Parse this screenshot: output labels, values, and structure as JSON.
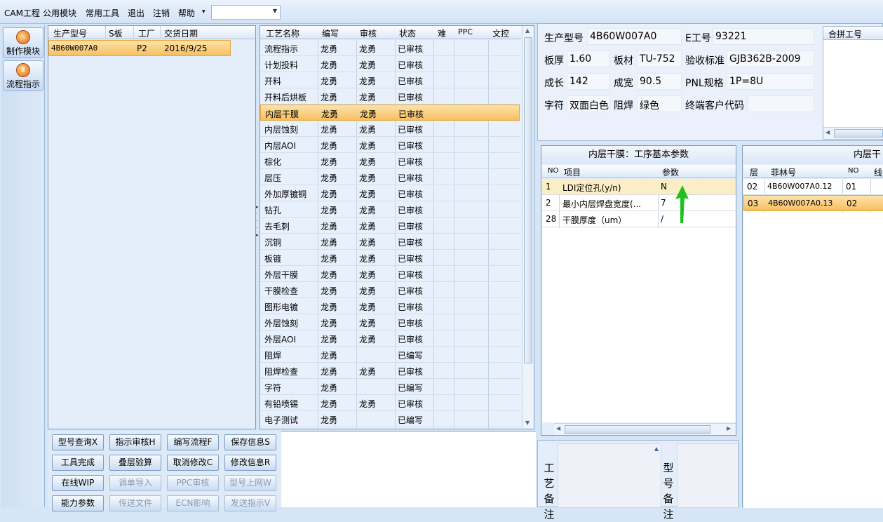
{
  "menu": {
    "items": [
      "CAM工程",
      "公用模块",
      "常用工具",
      "退出",
      "注销",
      "帮助"
    ],
    "dropdown_arrow": "▾",
    "combo_value": ""
  },
  "nav": {
    "make_module": "制作模块",
    "flow_guide": "流程指示"
  },
  "model_table": {
    "headers": [
      "生产型号",
      "S板",
      "工厂",
      "交货日期"
    ],
    "rows": [
      {
        "model": "4B60W007A0",
        "s": "",
        "factory": "P2",
        "date": "2016/9/25"
      }
    ]
  },
  "process_table": {
    "headers": [
      "工艺名称",
      "编写",
      "审核",
      "状态",
      "难",
      "PPC",
      "文控"
    ],
    "selected_index": 4,
    "rows": [
      {
        "name": "流程指示",
        "writer": "龙勇",
        "reviewer": "龙勇",
        "status": "已审核"
      },
      {
        "name": "计划投料",
        "writer": "龙勇",
        "reviewer": "龙勇",
        "status": "已审核"
      },
      {
        "name": "开料",
        "writer": "龙勇",
        "reviewer": "龙勇",
        "status": "已审核"
      },
      {
        "name": "开料后烘板",
        "writer": "龙勇",
        "reviewer": "龙勇",
        "status": "已审核"
      },
      {
        "name": "内层干膜",
        "writer": "龙勇",
        "reviewer": "龙勇",
        "status": "已审核"
      },
      {
        "name": "内层蚀刻",
        "writer": "龙勇",
        "reviewer": "龙勇",
        "status": "已审核"
      },
      {
        "name": "内层AOI",
        "writer": "龙勇",
        "reviewer": "龙勇",
        "status": "已审核"
      },
      {
        "name": "棕化",
        "writer": "龙勇",
        "reviewer": "龙勇",
        "status": "已审核"
      },
      {
        "name": "层压",
        "writer": "龙勇",
        "reviewer": "龙勇",
        "status": "已审核"
      },
      {
        "name": "外加厚镀铜",
        "writer": "龙勇",
        "reviewer": "龙勇",
        "status": "已审核"
      },
      {
        "name": "钻孔",
        "writer": "龙勇",
        "reviewer": "龙勇",
        "status": "已审核"
      },
      {
        "name": "去毛刺",
        "writer": "龙勇",
        "reviewer": "龙勇",
        "status": "已审核"
      },
      {
        "name": "沉铜",
        "writer": "龙勇",
        "reviewer": "龙勇",
        "status": "已审核"
      },
      {
        "name": "板镀",
        "writer": "龙勇",
        "reviewer": "龙勇",
        "status": "已审核"
      },
      {
        "name": "外层干膜",
        "writer": "龙勇",
        "reviewer": "龙勇",
        "status": "已审核"
      },
      {
        "name": "干膜检查",
        "writer": "龙勇",
        "reviewer": "龙勇",
        "status": "已审核"
      },
      {
        "name": "图形电镀",
        "writer": "龙勇",
        "reviewer": "龙勇",
        "status": "已审核"
      },
      {
        "name": "外层蚀刻",
        "writer": "龙勇",
        "reviewer": "龙勇",
        "status": "已审核"
      },
      {
        "name": "外层AOI",
        "writer": "龙勇",
        "reviewer": "龙勇",
        "status": "已审核"
      },
      {
        "name": "阻焊",
        "writer": "龙勇",
        "reviewer": "",
        "status": "已编写"
      },
      {
        "name": "阻焊检查",
        "writer": "龙勇",
        "reviewer": "龙勇",
        "status": "已审核"
      },
      {
        "name": "字符",
        "writer": "龙勇",
        "reviewer": "",
        "status": "已编写"
      },
      {
        "name": "有铅喷锡",
        "writer": "龙勇",
        "reviewer": "龙勇",
        "status": "已审核"
      },
      {
        "name": "电子测试",
        "writer": "龙勇",
        "reviewer": "",
        "status": "已编写"
      }
    ]
  },
  "info": {
    "model_label": "生产型号",
    "model_value": "4B60W007A0",
    "eno_label": "E工号",
    "eno_value": "93221",
    "thickness_label": "板厚",
    "thickness_value": "1.60",
    "material_label": "板材",
    "material_value": "TU-752",
    "standard_label": "验收标准",
    "standard_value": "GJB362B-2009",
    "length_label": "成长",
    "length_value": "142",
    "width_label": "成宽",
    "width_value": "90.5",
    "pnl_label": "PNL规格",
    "pnl_value": "1P=8U",
    "char_label": "字符",
    "char_value": "双面白色",
    "mask_label": "阻焊",
    "mask_value": "绿色",
    "customer_label": "终端客户代码",
    "customer_value": "",
    "combine_header": "合拼工号"
  },
  "params": {
    "title": "内层干膜：工序基本参数",
    "headers": [
      "NO",
      "项目",
      "参数"
    ],
    "rows": [
      {
        "no": "1",
        "item": "LDI定位孔(y/n)",
        "value": "N"
      },
      {
        "no": "2",
        "item": "最小内层焊盘宽度(...",
        "value": "7"
      },
      {
        "no": "28",
        "item": "干膜厚度（um）",
        "value": "/"
      }
    ]
  },
  "layers": {
    "title": "内层干",
    "headers": [
      "层",
      "菲林号",
      "NO",
      "线"
    ],
    "rows": [
      {
        "layer": "02",
        "film": "4B60W007A0.12",
        "no": "01"
      },
      {
        "layer": "03",
        "film": "4B60W007A0.13",
        "no": "02"
      }
    ]
  },
  "buttons": {
    "model_query": "型号查询X",
    "guide_review": "指示审核H",
    "edit_flow": "编写流程F",
    "save_info": "保存信息S",
    "tool_done": "工具完成",
    "stack_check": "叠层验算",
    "cancel_modify": "取消修改C",
    "modify_info": "修改信息R",
    "online_wip": "在线WIP",
    "import_order": "调单导入",
    "ppc_review": "PPC审核",
    "model_online": "型号上网W",
    "capability": "能力参数",
    "send_file": "传送文件",
    "ecn_impact": "ECN影响",
    "send_guide": "发送指示V"
  },
  "remarks": {
    "process_remark": "工艺备注",
    "model_remark": "型号备注"
  },
  "colors": {
    "accent_selection": "#f6c063",
    "green_arrow": "#22c01e"
  }
}
